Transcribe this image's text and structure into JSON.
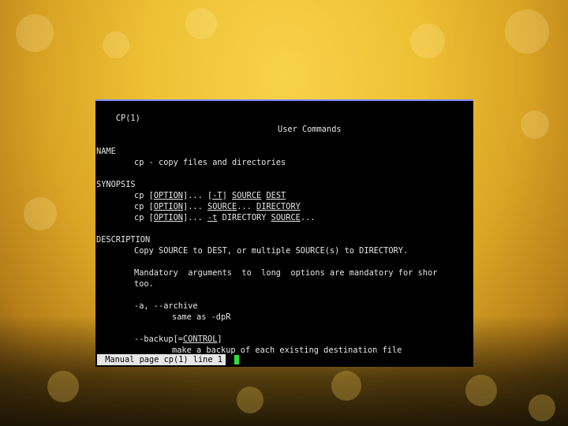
{
  "header": {
    "left": "CP(1)",
    "center": "User Commands"
  },
  "sections": {
    "name_title": "NAME",
    "name_desc": "cp - copy files and directories",
    "synopsis_title": "SYNOPSIS",
    "description_title": "DESCRIPTION",
    "desc_line1": "Copy SOURCE to DEST, or multiple SOURCE(s) to DIRECTORY.",
    "desc_line2": "Mandatory  arguments  to  long  options are mandatory for shor",
    "desc_line3": "too.",
    "archive_opt": "-a, --archive",
    "archive_desc": "same as -dpR",
    "backup_opt": "--backup",
    "backup_lb": "[=",
    "backup_arg": "CONTROL",
    "backup_rb": "]",
    "backup_desc": "make a backup of each existing destination file"
  },
  "synopsis": {
    "s1": {
      "cmd": "cp",
      "b1": "[",
      "opt": "OPTION",
      "b2": "]...",
      "b3": "[",
      "t": "-T",
      "b4": "]",
      "src": "SOURCE",
      "dest": "DEST"
    },
    "s2": {
      "cmd": "cp",
      "b1": "[",
      "opt": "OPTION",
      "b2": "]...",
      "src": "SOURCE",
      "dots": "...",
      "dir": "DIRECTORY"
    },
    "s3": {
      "cmd": "cp",
      "b1": "[",
      "opt": "OPTION",
      "b2": "]...",
      "t": "-t",
      "dir": "DIRECTORY",
      "src": "SOURCE",
      "dots": "..."
    }
  },
  "status": {
    "text": " Manual page cp(1) line 1"
  },
  "colors": {
    "cursor": "#2fe03a",
    "terminal_bg": "#000000",
    "desktop": "#eec033"
  }
}
